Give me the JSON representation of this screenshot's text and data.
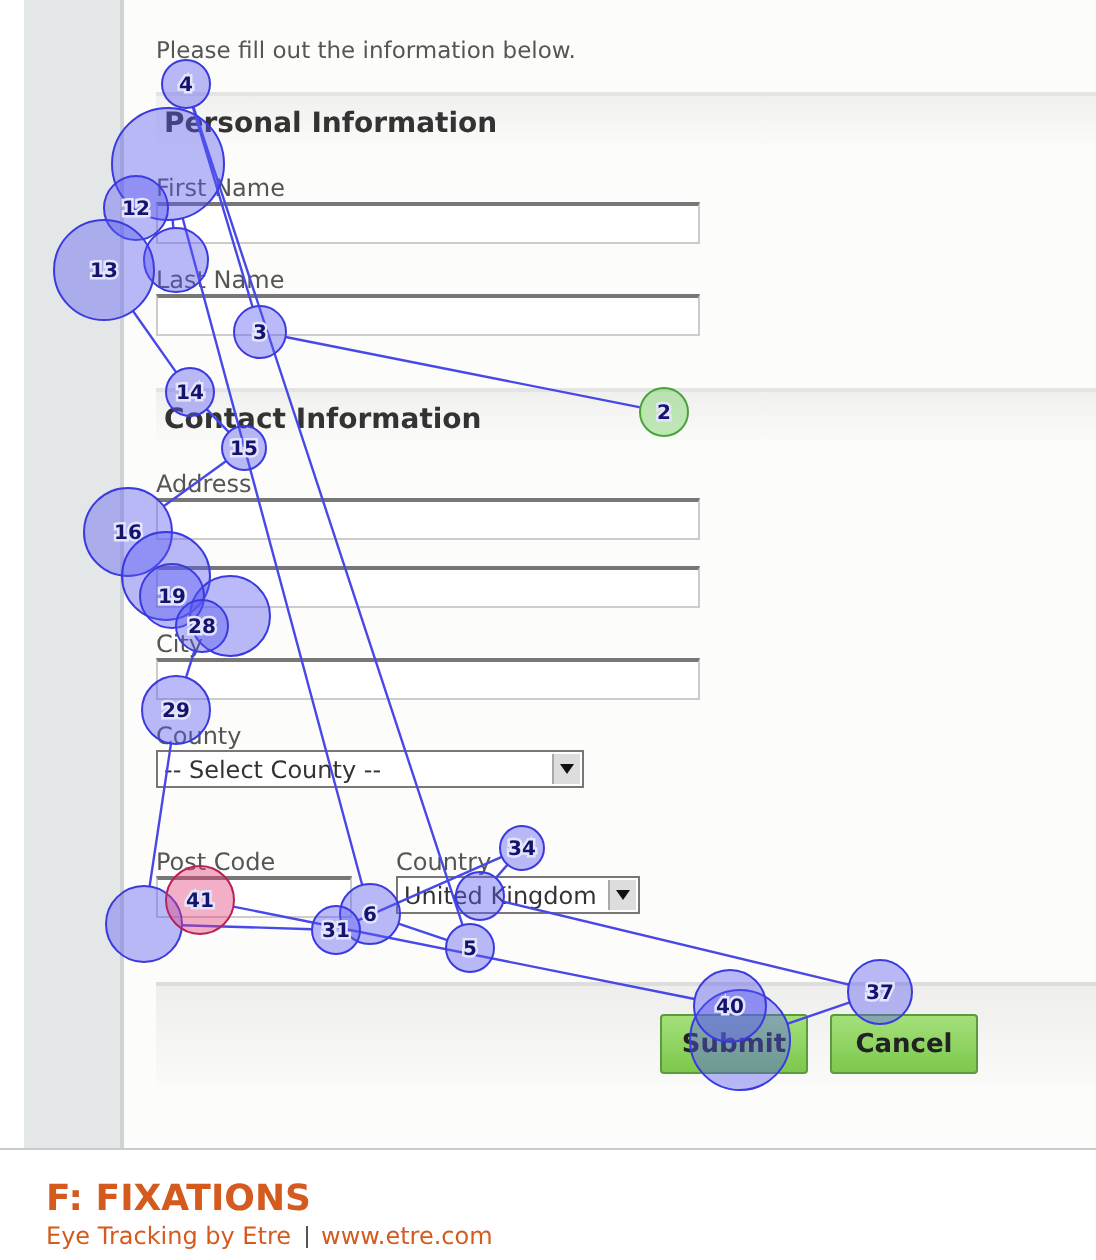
{
  "intro": "Please fill out the information below.",
  "sections": [
    {
      "title": "Personal Information",
      "fields": [
        {
          "kind": "text",
          "label": "First Name"
        },
        {
          "kind": "text",
          "label": "Last Name"
        }
      ]
    },
    {
      "title": "Contact Information",
      "fields": [
        {
          "kind": "text",
          "label": "Address"
        },
        {
          "kind": "text"
        },
        {
          "kind": "text",
          "label": "City"
        },
        {
          "kind": "select",
          "label": "County",
          "value": "-- Select County --"
        }
      ]
    }
  ],
  "bottom_fields": [
    {
      "kind": "text",
      "label": "Post Code"
    },
    {
      "kind": "select",
      "label": "Country",
      "value": "United Kingdom"
    }
  ],
  "buttons": [
    "Submit",
    "Cancel"
  ],
  "fixations": [
    {
      "label": "2",
      "kind": "start"
    },
    {
      "label": "3",
      "kind": "fixation"
    },
    {
      "label": "4",
      "kind": "fixation"
    },
    {
      "label": "5",
      "kind": "fixation"
    },
    {
      "label": "6",
      "kind": "fixation"
    },
    {
      "kind": "fixation"
    },
    {
      "kind": "fixation"
    },
    {
      "label": "12",
      "kind": "fixation"
    },
    {
      "label": "13",
      "kind": "fixation"
    },
    {
      "label": "14",
      "kind": "fixation"
    },
    {
      "label": "15",
      "kind": "fixation"
    },
    {
      "label": "16",
      "kind": "fixation"
    },
    {
      "kind": "fixation"
    },
    {
      "kind": "fixation"
    },
    {
      "label": "19",
      "kind": "fixation"
    },
    {
      "label": "28",
      "kind": "fixation"
    },
    {
      "label": "29",
      "kind": "fixation"
    },
    {
      "kind": "fixation"
    },
    {
      "label": "31",
      "kind": "fixation"
    },
    {
      "label": "34",
      "kind": "fixation"
    },
    {
      "kind": "fixation"
    },
    {
      "label": "37",
      "kind": "fixation"
    },
    {
      "kind": "fixation"
    },
    {
      "label": "40",
      "kind": "fixation"
    },
    {
      "label": "41",
      "kind": "end"
    }
  ],
  "caption": {
    "title": "F: FIXATIONS",
    "credit": "Eye Tracking by Etre",
    "url": "www.etre.com"
  }
}
